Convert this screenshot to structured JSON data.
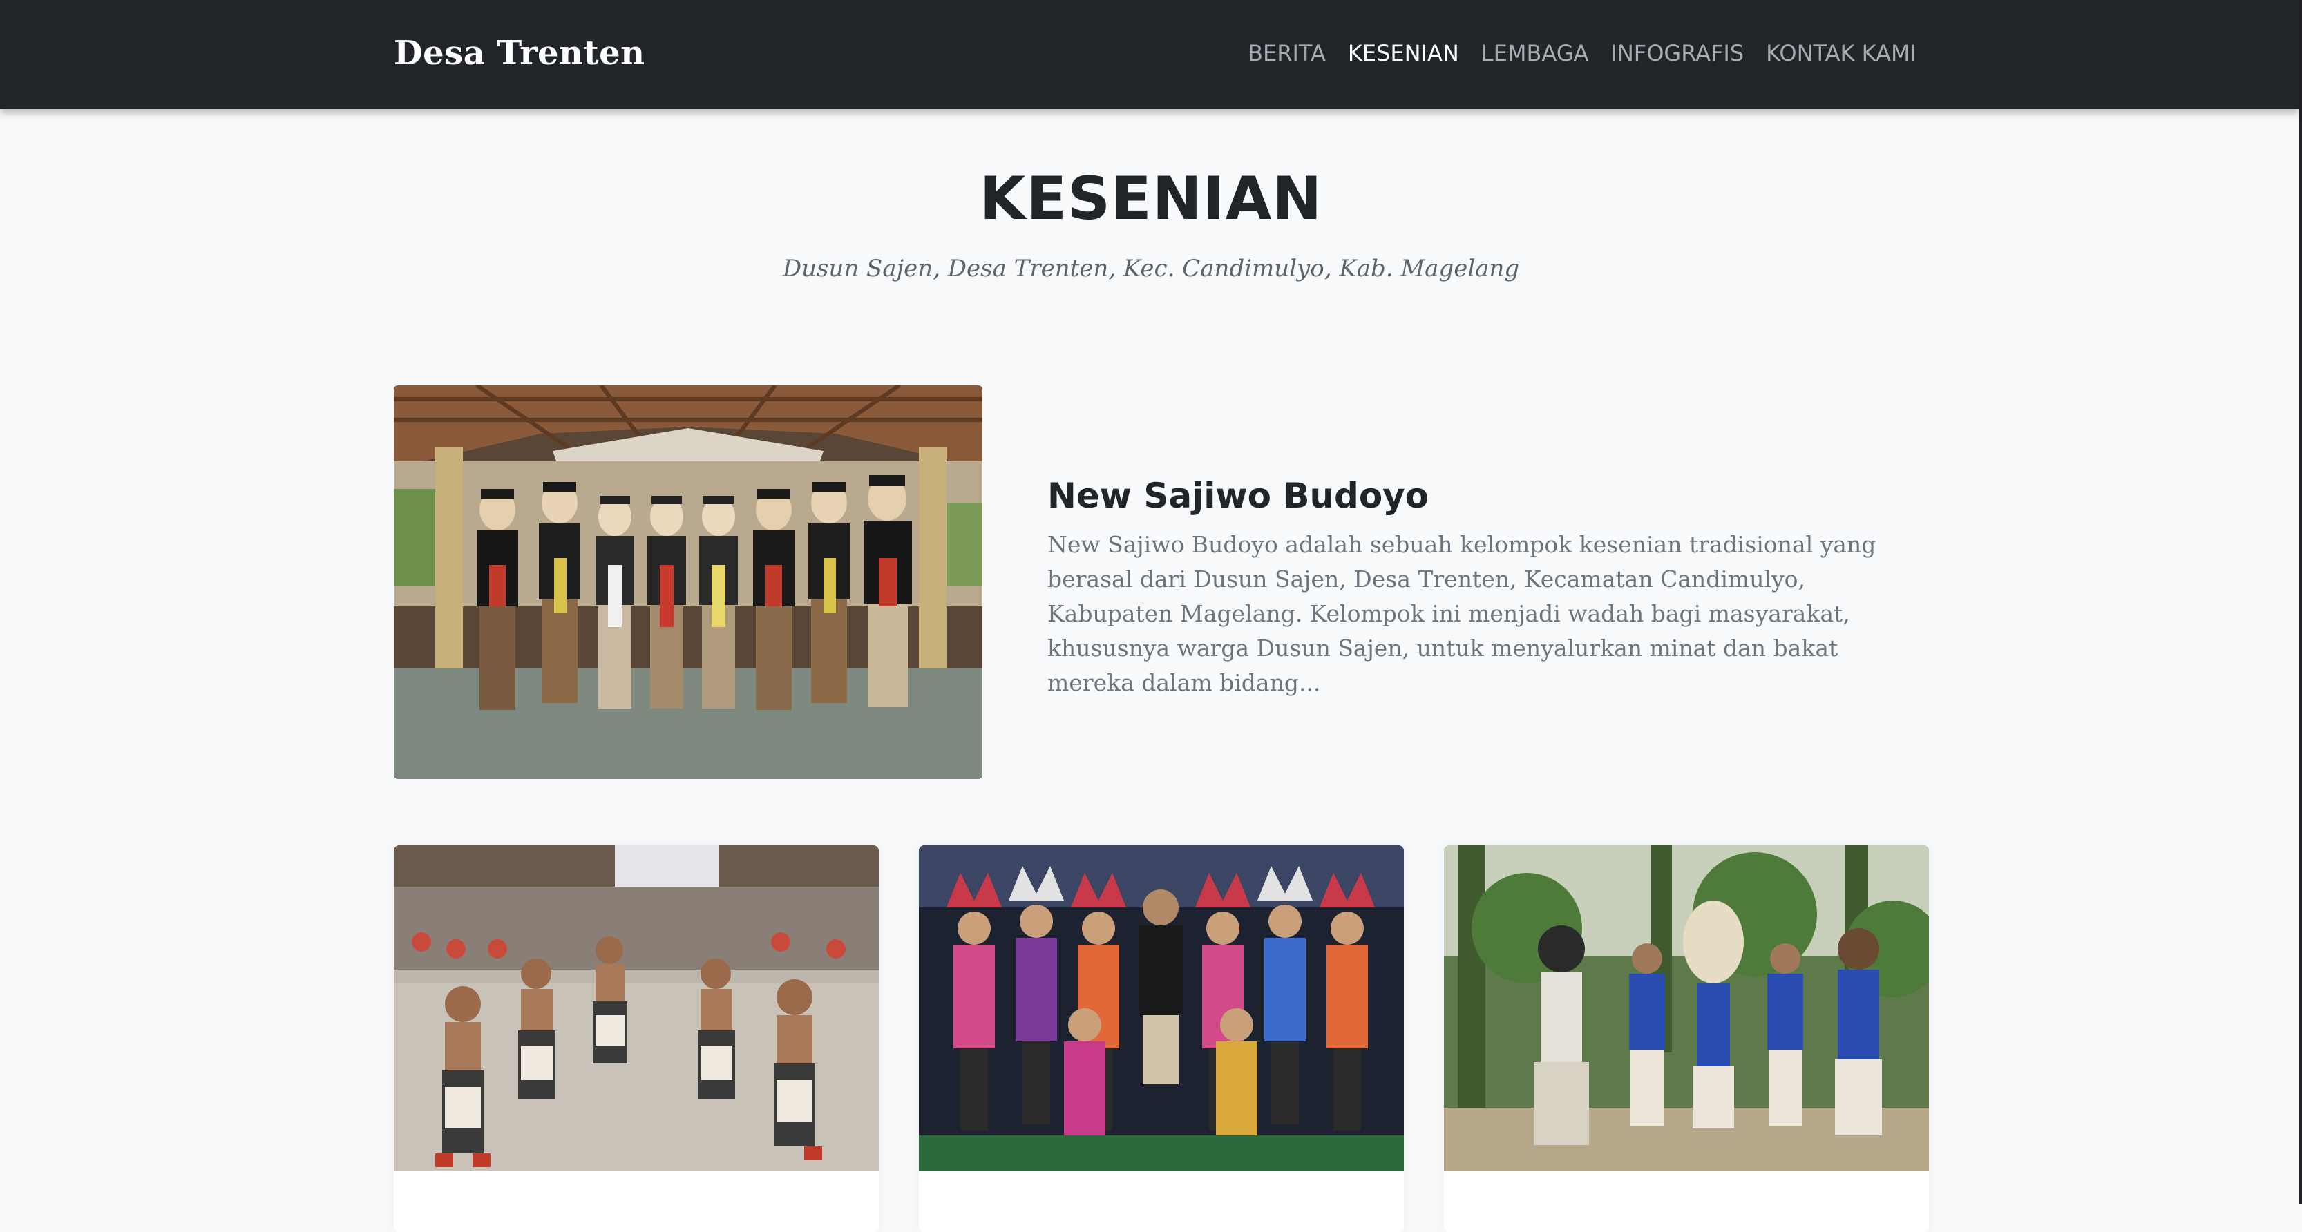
{
  "navbar": {
    "brand": "Desa Trenten",
    "links": [
      {
        "label": "BERITA",
        "active": false
      },
      {
        "label": "KESENIAN",
        "active": true
      },
      {
        "label": "LEMBAGA",
        "active": false
      },
      {
        "label": "INFOGRAFIS",
        "active": false
      },
      {
        "label": "KONTAK KAMI",
        "active": false
      }
    ]
  },
  "header": {
    "title": "KESENIAN",
    "subtitle": "Dusun Sajen, Desa Trenten, Kec. Candimulyo, Kab. Magelang"
  },
  "featured": {
    "title": "New Sajiwo Budoyo",
    "excerpt": "New Sajiwo Budoyo adalah sebuah kelompok kesenian tradisional yang berasal dari Dusun Sajen, Desa Trenten, Kecamatan Candimulyo, Kabupaten Magelang. Kelompok ini menjadi wadah bagi masyarakat, khususnya warga Dusun Sajen, untuk menyalurkan minat dan bakat mereka dalam bidang..."
  },
  "colors": {
    "navbar_bg": "#212529",
    "nav_active": "#ffffff",
    "nav_inactive": "#a8acb2",
    "page_bg": "#f8f9fa",
    "heading": "#212529",
    "body_text": "#6c757d"
  }
}
